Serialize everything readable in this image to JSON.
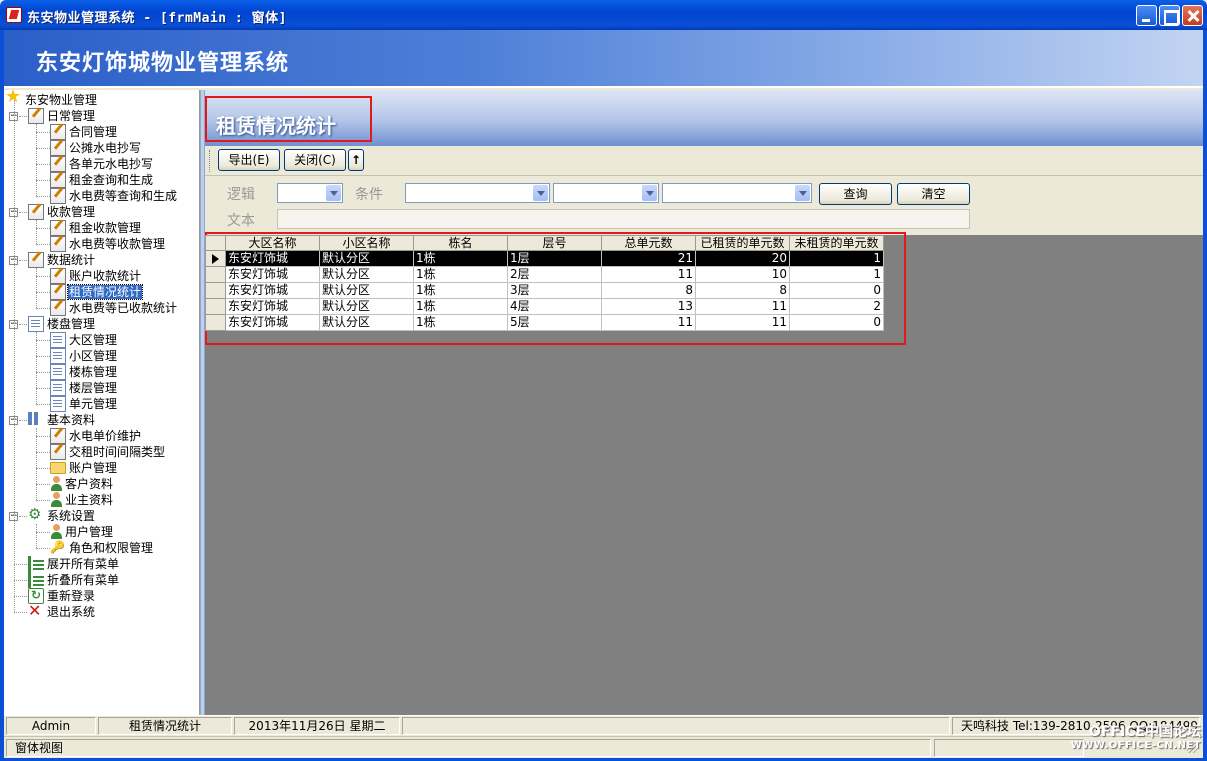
{
  "window": {
    "title": "东安物业管理系统 - [frmMain : 窗体]"
  },
  "banner": {
    "title": "东安灯饰城物业管理系统"
  },
  "tree": {
    "root": "东安物业管理",
    "groups": [
      {
        "label": "日常管理",
        "icon": "document-edit-icon",
        "items": [
          "合同管理",
          "公摊水电抄写",
          "各单元水电抄写",
          "租金查询和生成",
          "水电费等查询和生成"
        ]
      },
      {
        "label": "收款管理",
        "icon": "document-edit-icon",
        "items": [
          "租金收款管理",
          "水电费等收款管理"
        ]
      },
      {
        "label": "数据统计",
        "icon": "document-edit-icon",
        "items": [
          "账户收款统计",
          "租赁情况统计",
          "水电费等已收款统计"
        ]
      },
      {
        "label": "楼盘管理",
        "icon": "page-icon",
        "items": [
          "大区管理",
          "小区管理",
          "楼栋管理",
          "楼层管理",
          "单元管理"
        ]
      },
      {
        "label": "基本资料",
        "icon": "tools-icon",
        "items": [
          "水电单价维护",
          "交租时间间隔类型",
          "账户管理",
          "客户资料",
          "业主资料"
        ]
      },
      {
        "label": "系统设置",
        "icon": "gear-icon",
        "items": [
          "用户管理",
          "角色和权限管理"
        ]
      }
    ],
    "actions": [
      "展开所有菜单",
      "折叠所有菜单",
      "重新登录",
      "退出系统"
    ],
    "selected": "租赁情况统计"
  },
  "page": {
    "title": "租赁情况统计"
  },
  "toolbar": {
    "export_label": "导出(E)",
    "close_label": "关闭(C)",
    "up_label": "↑"
  },
  "filter": {
    "logic_label": "逻辑",
    "condition_label": "条件",
    "text_label": "文本",
    "query_label": "查询",
    "clear_label": "清空"
  },
  "grid": {
    "columns": [
      "大区名称",
      "小区名称",
      "栋名",
      "层号",
      "总单元数",
      "已租赁的单元数",
      "未租赁的单元数"
    ],
    "rows": [
      [
        "东安灯饰城",
        "默认分区",
        "1栋",
        "1层",
        "21",
        "20",
        "1"
      ],
      [
        "东安灯饰城",
        "默认分区",
        "1栋",
        "2层",
        "11",
        "10",
        "1"
      ],
      [
        "东安灯饰城",
        "默认分区",
        "1栋",
        "3层",
        "8",
        "8",
        "0"
      ],
      [
        "东安灯饰城",
        "默认分区",
        "1栋",
        "4层",
        "13",
        "11",
        "2"
      ],
      [
        "东安灯饰城",
        "默认分区",
        "1栋",
        "5层",
        "11",
        "11",
        "0"
      ]
    ],
    "current_row": 0
  },
  "status": {
    "user": "Admin",
    "module": "租赁情况统计",
    "date": "2013年11月26日 星期二",
    "company": "天鸣科技 Tel:139-2810-2596 QQ:18449932"
  },
  "bottombar": {
    "label": "窗体视图"
  },
  "watermark": {
    "line1": "OFFICE中国论坛",
    "line2": "WWW.OFFICE-CN.NET"
  },
  "colors": {
    "highlight_border": "#e41818",
    "title_blue": "#0a4fd6",
    "selection": "#316ac5"
  }
}
